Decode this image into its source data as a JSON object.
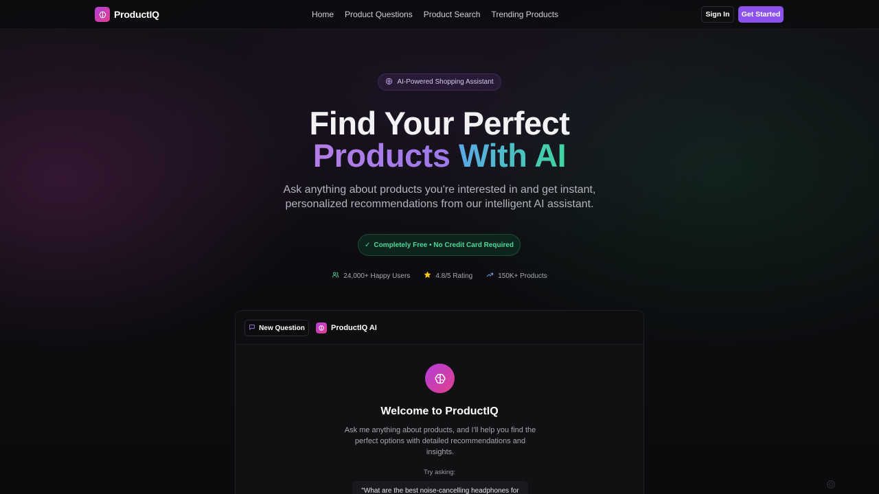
{
  "nav": {
    "brand": "ProductIQ",
    "links": [
      "Home",
      "Product Questions",
      "Product Search",
      "Trending Products"
    ],
    "sign_in": "Sign In",
    "get_started": "Get Started"
  },
  "hero": {
    "badge": "AI-Powered Shopping Assistant",
    "title_line1": "Find Your Perfect",
    "title_line2_a": "Products",
    "title_line2_b": "With AI",
    "subtitle_line1": "Ask anything about products you're interested in and get instant,",
    "subtitle_line2": "personalized recommendations from our intelligent AI assistant.",
    "free_pill": "Completely Free • No Credit Card Required",
    "stats": [
      {
        "icon": "users-icon",
        "label": "24,000+ Happy Users"
      },
      {
        "icon": "star-icon",
        "label": "4.8/5 Rating"
      },
      {
        "icon": "trending-up-icon",
        "label": "150K+ Products"
      }
    ]
  },
  "chat": {
    "new_question": "New Question",
    "assistant_name": "ProductIQ AI",
    "welcome_title": "Welcome to ProductIQ",
    "welcome_sub_line1": "Ask me anything about products, and I'll help you find the",
    "welcome_sub_line2": "perfect options with detailed recommendations and",
    "welcome_sub_line3": "insights.",
    "try_asking": "Try asking:",
    "example_question": "\"What are the best noise-cancelling headphones for"
  },
  "colors": {
    "accent": "#8b52f0",
    "brand_gradient_start": "#b43dd8",
    "brand_gradient_end": "#e0408e",
    "success": "#4fd89a"
  }
}
